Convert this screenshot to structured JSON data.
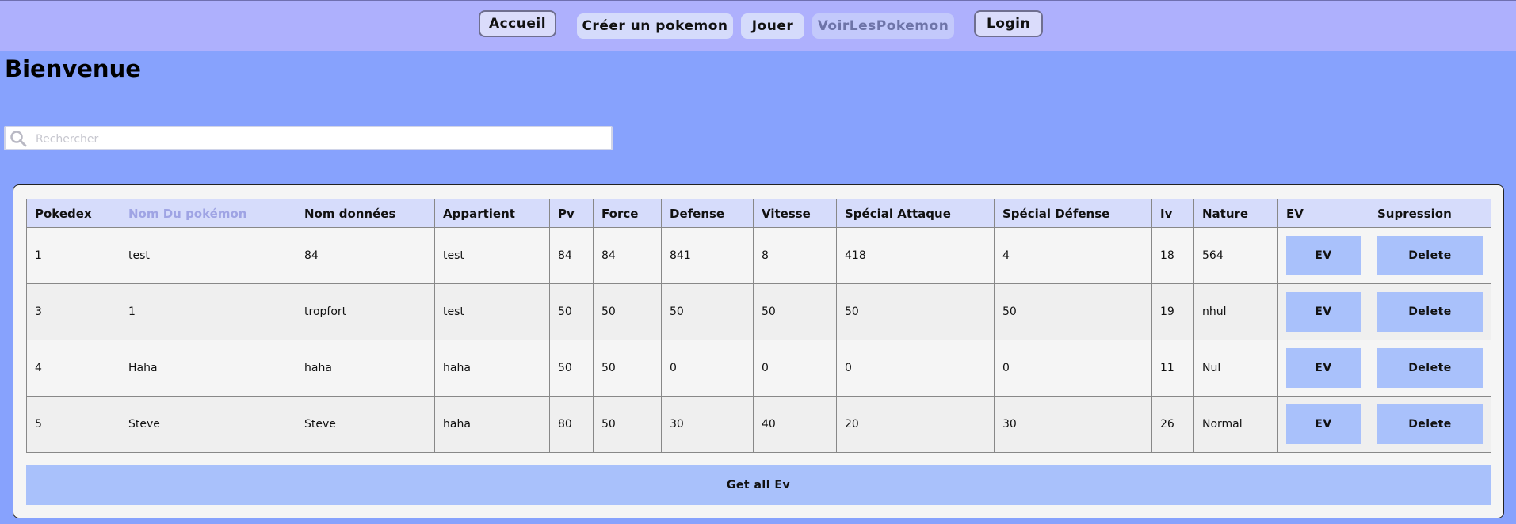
{
  "nav": {
    "accueil": "Accueil",
    "creer": "Créer un pokemon",
    "jouer": "Jouer",
    "voir": "VoirLesPokemon",
    "login": "Login"
  },
  "page": {
    "title": "Bienvenue"
  },
  "search": {
    "placeholder": "Rechercher",
    "value": ""
  },
  "table": {
    "headers": [
      "Pokedex",
      "Nom Du pokémon",
      "Nom données",
      "Appartient",
      "Pv",
      "Force",
      "Defense",
      "Vitesse",
      "Spécial Attaque",
      "Spécial Défense",
      "Iv",
      "Nature",
      "EV",
      "Supression"
    ],
    "rows": [
      {
        "pokedex": "1",
        "nom": "test",
        "nom_donnees": "84",
        "appartient": "test",
        "pv": "84",
        "force": "84",
        "defense": "841",
        "vitesse": "8",
        "sp_attaque": "418",
        "sp_defense": "4",
        "iv": "18",
        "nature": "564",
        "ev_label": "EV",
        "delete_label": "Delete"
      },
      {
        "pokedex": "3",
        "nom": "1",
        "nom_donnees": "tropfort",
        "appartient": "test",
        "pv": "50",
        "force": "50",
        "defense": "50",
        "vitesse": "50",
        "sp_attaque": "50",
        "sp_defense": "50",
        "iv": "19",
        "nature": "nhul",
        "ev_label": "EV",
        "delete_label": "Delete"
      },
      {
        "pokedex": "4",
        "nom": "Haha",
        "nom_donnees": "haha",
        "appartient": "haha",
        "pv": "50",
        "force": "50",
        "defense": "0",
        "vitesse": "0",
        "sp_attaque": "0",
        "sp_defense": "0",
        "iv": "11",
        "nature": "Nul",
        "ev_label": "EV",
        "delete_label": "Delete"
      },
      {
        "pokedex": "5",
        "nom": "Steve",
        "nom_donnees": "Steve",
        "appartient": "haha",
        "pv": "80",
        "force": "50",
        "defense": "30",
        "vitesse": "40",
        "sp_attaque": "20",
        "sp_defense": "30",
        "iv": "26",
        "nature": "Normal",
        "ev_label": "EV",
        "delete_label": "Delete"
      }
    ]
  },
  "actions": {
    "get_all_ev": "Get all Ev"
  },
  "icons": {
    "search": "search-icon"
  },
  "colors": {
    "background": "#87a2fd",
    "topbar": "#aeb0fd",
    "button": "#a9c1fb",
    "header": "#d6dcfb"
  }
}
